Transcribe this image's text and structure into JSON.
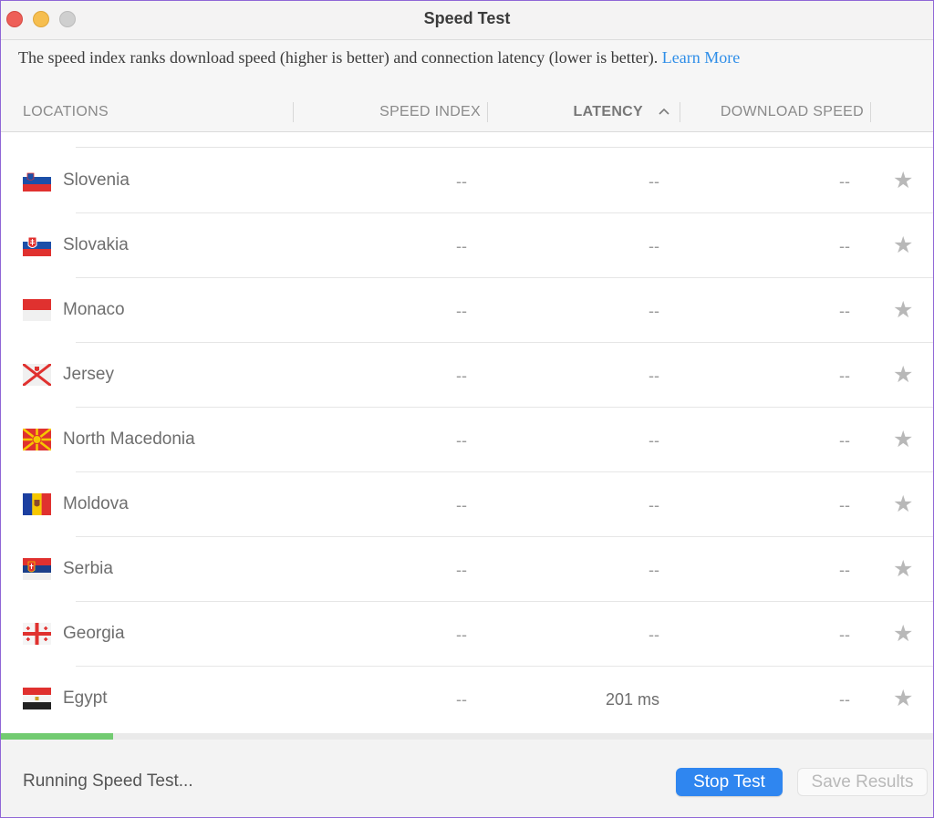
{
  "window": {
    "title": "Speed Test"
  },
  "info": {
    "text": "The speed index ranks download speed (higher is better) and connection latency (lower is better).",
    "link": "Learn More"
  },
  "columns": {
    "locations": "LOCATIONS",
    "speed_index": "SPEED INDEX",
    "latency": "LATENCY",
    "download_speed": "DOWNLOAD SPEED",
    "sort_indicator": "^"
  },
  "rows": [
    {
      "country": "Slovenia",
      "flag": "slovenia-flag",
      "speed_index": "--",
      "latency": "--",
      "download": "--"
    },
    {
      "country": "Slovakia",
      "flag": "slovakia-flag",
      "speed_index": "--",
      "latency": "--",
      "download": "--"
    },
    {
      "country": "Monaco",
      "flag": "monaco-flag",
      "speed_index": "--",
      "latency": "--",
      "download": "--"
    },
    {
      "country": "Jersey",
      "flag": "jersey-flag",
      "speed_index": "--",
      "latency": "--",
      "download": "--"
    },
    {
      "country": "North Macedonia",
      "flag": "north-macedonia-flag",
      "speed_index": "--",
      "latency": "--",
      "download": "--"
    },
    {
      "country": "Moldova",
      "flag": "moldova-flag",
      "speed_index": "--",
      "latency": "--",
      "download": "--"
    },
    {
      "country": "Serbia",
      "flag": "serbia-flag",
      "speed_index": "--",
      "latency": "--",
      "download": "--"
    },
    {
      "country": "Georgia",
      "flag": "georgia-flag",
      "speed_index": "--",
      "latency": "--",
      "download": "--"
    },
    {
      "country": "Egypt",
      "flag": "egypt-flag",
      "speed_index": "--",
      "latency": "201 ms",
      "download": "--"
    }
  ],
  "progress": {
    "fraction": 0.12,
    "color": "#72cb71"
  },
  "footer": {
    "status": "Running Speed Test...",
    "stop_label": "Stop Test",
    "save_label": "Save Results"
  },
  "colors": {
    "accent": "#2f86f0",
    "link": "#2f8ee8"
  }
}
